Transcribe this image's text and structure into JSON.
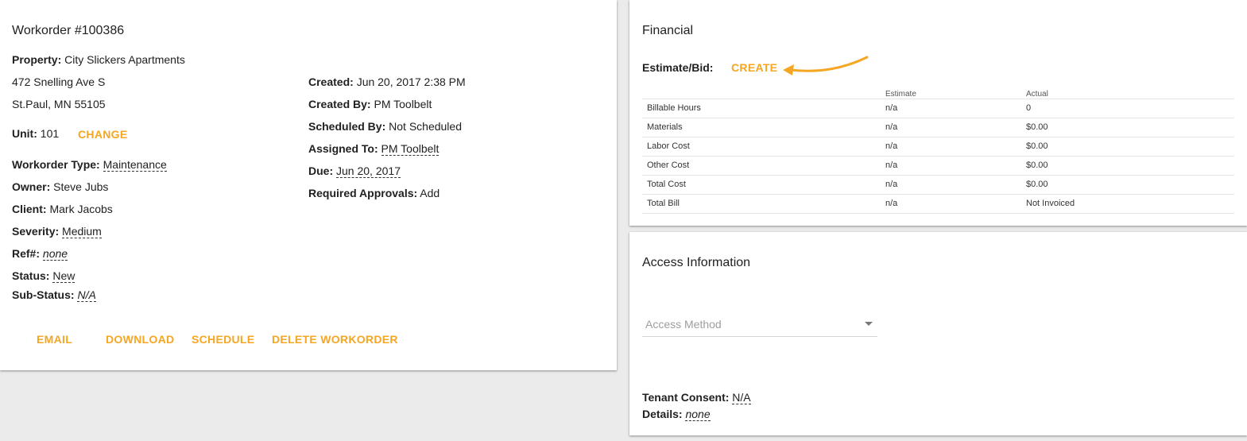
{
  "workorder": {
    "title": "Workorder #100386",
    "property_label": "Property:",
    "property_value": "City Slickers Apartments",
    "address_line1": "472 Snelling Ave S",
    "address_line2": "St.Paul, MN 55105",
    "unit_label": "Unit:",
    "unit_value": "101",
    "change_label": "CHANGE",
    "type_label": "Workorder Type:",
    "type_value": "Maintenance",
    "owner_label": "Owner:",
    "owner_value": "Steve Jubs",
    "client_label": "Client:",
    "client_value": "Mark Jacobs",
    "severity_label": "Severity:",
    "severity_value": "Medium",
    "ref_label": "Ref#:",
    "ref_value": "none",
    "status_label": "Status:",
    "status_value": "New",
    "substatus_label": "Sub-Status:",
    "substatus_value": "N/A",
    "created_label": "Created:",
    "created_value": "Jun 20, 2017 2:38 PM",
    "created_by_label": "Created By:",
    "created_by_value": "PM Toolbelt",
    "scheduled_by_label": "Scheduled By:",
    "scheduled_by_value": "Not Scheduled",
    "assigned_to_label": "Assigned To:",
    "assigned_to_value": "PM Toolbelt",
    "due_label": "Due:",
    "due_value": "Jun 20, 2017",
    "approvals_label": "Required Approvals:",
    "approvals_value": "Add",
    "actions": {
      "email": "EMAIL",
      "download": "DOWNLOAD",
      "schedule": "SCHEDULE",
      "delete": "DELETE WORKORDER"
    }
  },
  "financial": {
    "title": "Financial",
    "estimate_label": "Estimate/Bid:",
    "create_label": "CREATE",
    "table": {
      "headers": [
        "",
        "Estimate",
        "Actual"
      ],
      "rows": [
        [
          "Billable Hours",
          "n/a",
          "0"
        ],
        [
          "Materials",
          "n/a",
          "$0.00"
        ],
        [
          "Labor Cost",
          "n/a",
          "$0.00"
        ],
        [
          "Other Cost",
          "n/a",
          "$0.00"
        ],
        [
          "Total Cost",
          "n/a",
          "$0.00"
        ],
        [
          "Total Bill",
          "n/a",
          "Not Invoiced"
        ]
      ]
    }
  },
  "access": {
    "title": "Access Information",
    "method_placeholder": "Access Method",
    "consent_label": "Tenant Consent:",
    "consent_value": "N/A",
    "details_label": "Details:",
    "details_value": "none"
  },
  "colors": {
    "accent": "#f5a623",
    "background": "#ebebeb",
    "card": "#ffffff"
  }
}
